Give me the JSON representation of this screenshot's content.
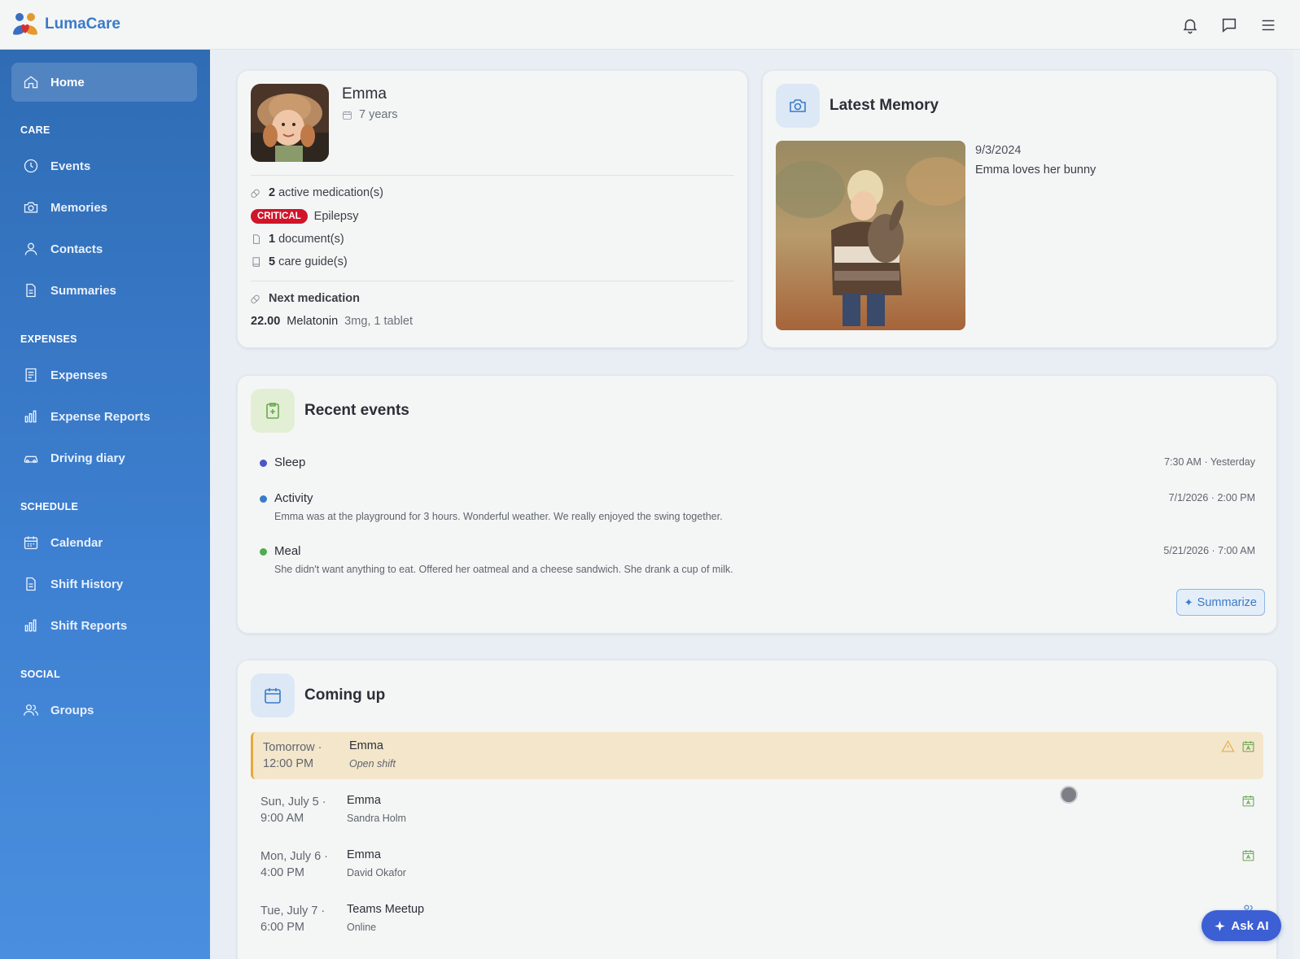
{
  "app": {
    "name": "LumaCare"
  },
  "header": {
    "icons": [
      "bell-icon",
      "chat-icon",
      "menu-icon"
    ]
  },
  "sidebar": {
    "home": "Home",
    "sections": {
      "care": "CARE",
      "expenses": "EXPENSES",
      "schedule": "SCHEDULE",
      "social": "SOCIAL"
    },
    "items": {
      "events": "Events",
      "memories": "Memories",
      "contacts": "Contacts",
      "summaries": "Summaries",
      "expenses": "Expenses",
      "expense_reports": "Expense Reports",
      "driving_diary": "Driving diary",
      "calendar": "Calendar",
      "shift_history": "Shift History",
      "shift_reports": "Shift Reports",
      "groups": "Groups"
    }
  },
  "profile": {
    "name": "Emma",
    "age": "7 years",
    "medications_count": "2",
    "medications_label": "active medication(s)",
    "critical_badge": "CRITICAL",
    "condition": "Epilepsy",
    "documents_count": "1",
    "documents_label": "document(s)",
    "guides_count": "5",
    "guides_label": "care guide(s)",
    "next_medication_label": "Next medication",
    "next_medication_time": "22.00",
    "next_medication_name": "Melatonin",
    "next_medication_dose": "3mg, 1 tablet"
  },
  "memory": {
    "title": "Latest Memory",
    "date": "9/3/2024",
    "caption": "Emma loves her bunny"
  },
  "recent_events": {
    "title": "Recent events",
    "items": [
      {
        "title": "Sleep",
        "desc": "",
        "time": "7:30 AM · Yesterday",
        "color": "#4a55c9"
      },
      {
        "title": "Activity",
        "desc": "Emma was at the playground for 3 hours. Wonderful weather. We really enjoyed the swing together.",
        "time": "7/1/2026 · 2:00 PM",
        "color": "#3a7bc8"
      },
      {
        "title": "Meal",
        "desc": "She didn't want anything to eat. Offered her oatmeal and a cheese sandwich. She drank a cup of milk.",
        "time": "5/21/2026 · 7:00 AM",
        "color": "#4cae4f"
      }
    ],
    "summarize_label": "Summarize"
  },
  "coming_up": {
    "title": "Coming up",
    "items": [
      {
        "when1": "Tomorrow ·",
        "when2": "12:00 PM",
        "who": "Emma",
        "sub": "Open shift"
      },
      {
        "when1": "Sun, July 5 ·",
        "when2": "9:00 AM",
        "who": "Emma",
        "sub": "Sandra Holm"
      },
      {
        "when1": "Mon, July 6 ·",
        "when2": "4:00 PM",
        "who": "Emma",
        "sub": "David Okafor"
      },
      {
        "when1": "Tue, July 7 ·",
        "when2": "6:00 PM",
        "who": "Teams Meetup",
        "sub": "Online"
      }
    ]
  },
  "ask_ai": "Ask AI",
  "colors": {
    "accent": "#3a7bc8",
    "critical": "#d0142a",
    "ai_button": "#3c5fd4",
    "highlight": "#f3e6cb"
  }
}
